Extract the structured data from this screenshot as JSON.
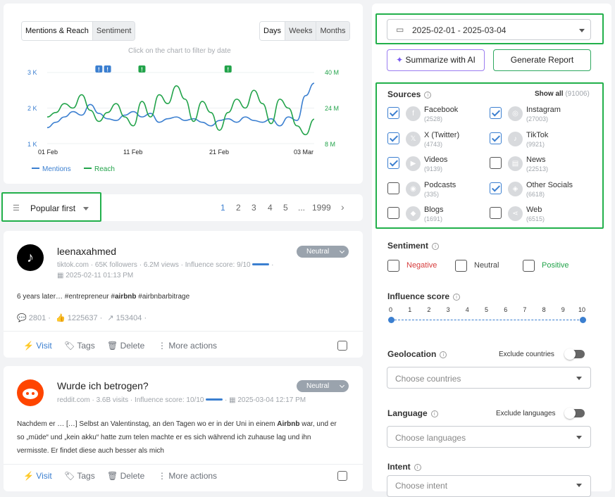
{
  "chart": {
    "tabs": [
      "Mentions & Reach",
      "Sentiment"
    ],
    "period_tabs": [
      "Days",
      "Weeks",
      "Months"
    ],
    "hint": "Click on the chart to filter by date",
    "y_left_ticks": [
      "3 K",
      "2 K",
      "1 K"
    ],
    "y_right_ticks": [
      "40 M",
      "24 M",
      "8 M"
    ],
    "x_ticks": [
      "01 Feb",
      "11 Feb",
      "21 Feb",
      "03 Mar"
    ],
    "legend": [
      "Mentions",
      "Reach"
    ],
    "colors": {
      "mentions": "#3b7fd0",
      "reach": "#22a34a"
    }
  },
  "chart_data": {
    "type": "line",
    "x": [
      "2025-02-01",
      "2025-02-02",
      "2025-02-03",
      "2025-02-04",
      "2025-02-05",
      "2025-02-06",
      "2025-02-07",
      "2025-02-08",
      "2025-02-09",
      "2025-02-10",
      "2025-02-11",
      "2025-02-12",
      "2025-02-13",
      "2025-02-14",
      "2025-02-15",
      "2025-02-16",
      "2025-02-17",
      "2025-02-18",
      "2025-02-19",
      "2025-02-20",
      "2025-02-21",
      "2025-02-22",
      "2025-02-23",
      "2025-02-24",
      "2025-02-25",
      "2025-02-26",
      "2025-02-27",
      "2025-02-28",
      "2025-03-01",
      "2025-03-02",
      "2025-03-03",
      "2025-03-04"
    ],
    "series": [
      {
        "name": "Mentions",
        "axis": "left",
        "values": [
          1450,
          1600,
          1750,
          1900,
          1800,
          2100,
          1850,
          1700,
          1650,
          1800,
          1900,
          1750,
          1850,
          1600,
          1700,
          1750,
          1650,
          1700,
          1600,
          1500,
          1650,
          1700,
          1600,
          1750,
          1650,
          1600,
          1700,
          1500,
          1750,
          1650,
          2350,
          2700
        ]
      },
      {
        "name": "Reach",
        "axis": "right",
        "values": [
          20,
          22,
          26,
          24,
          30,
          23,
          18,
          22,
          26,
          20,
          16,
          27,
          20,
          30,
          26,
          34,
          28,
          18,
          27,
          22,
          14,
          22,
          28,
          24,
          32,
          26,
          17,
          28,
          24,
          16,
          12,
          19
        ]
      }
    ],
    "ylim_left": [
      1000,
      3000
    ],
    "ylim_right": [
      8,
      40
    ],
    "flag_markers": [
      "!",
      "!",
      "!",
      "!"
    ]
  },
  "sort": {
    "label": "Popular first"
  },
  "pagination": {
    "pages": [
      "1",
      "2",
      "3",
      "4",
      "5",
      "...",
      "1999"
    ],
    "next": "›"
  },
  "posts": [
    {
      "author": "leenaxahmed",
      "sentiment": "Neutral",
      "meta": [
        "tiktok.com",
        "65K followers",
        "6.2M views",
        "Influence score: 9/10"
      ],
      "date": "2025-02-11 01:13 PM",
      "text_pre": "6 years later… #entrepreneur #",
      "text_bold": "airbnb",
      "text_post": " #airbnbarbitrage",
      "stats": {
        "comments": "2801",
        "likes": "1225637",
        "shares": "153404"
      }
    },
    {
      "author": "Wurde ich betrogen?",
      "sentiment": "Neutral",
      "meta": [
        "reddit.com",
        "3.6B visits",
        "Influence score: 10/10"
      ],
      "date": "2025-03-04 12:17 PM",
      "line1_pre": "Nachdem er … […] Selbst an Valentinstag, an den Tagen wo er in der Uni in einem ",
      "line1_bold": "Airbnb",
      "line1_post": " war, und er",
      "line2": "so „müde“ und „kein akku“ hatte zum telen machte er es sich während ich zuhause lag und ihn",
      "line3": "vermisste. Er findet diese auch besser als mich"
    }
  ],
  "actions": {
    "visit": "Visit",
    "tags": "Tags",
    "delete": "Delete",
    "more": "More actions"
  },
  "filters": {
    "date_range": "2025-02-01 - 2025-03-04",
    "summarize": "Summarize with AI",
    "report": "Generate Report",
    "sources_title": "Sources",
    "show_all": "Show all",
    "show_all_count": "(91006)",
    "sources": [
      {
        "name": "Facebook",
        "count": "(2528)",
        "checked": true
      },
      {
        "name": "Instagram",
        "count": "(27003)",
        "checked": true
      },
      {
        "name": "X (Twitter)",
        "count": "(4743)",
        "checked": true
      },
      {
        "name": "TikTok",
        "count": "(9921)",
        "checked": true
      },
      {
        "name": "Videos",
        "count": "(9139)",
        "checked": true
      },
      {
        "name": "News",
        "count": "(22513)",
        "checked": false
      },
      {
        "name": "Podcasts",
        "count": "(335)",
        "checked": false
      },
      {
        "name": "Other Socials",
        "count": "(6618)",
        "checked": true
      },
      {
        "name": "Blogs",
        "count": "(1691)",
        "checked": false
      },
      {
        "name": "Web",
        "count": "(6515)",
        "checked": false
      }
    ],
    "sentiment_title": "Sentiment",
    "sentiment_opts": [
      "Negative",
      "Neutral",
      "Positive"
    ],
    "influence_title": "Influence score",
    "influence_ticks": [
      "0",
      "1",
      "2",
      "3",
      "4",
      "5",
      "6",
      "7",
      "8",
      "9",
      "10"
    ],
    "influence_range": [
      0,
      10
    ],
    "geo_title": "Geolocation",
    "geo_exclude": "Exclude countries",
    "geo_placeholder": "Choose countries",
    "lang_title": "Language",
    "lang_exclude": "Exclude languages",
    "lang_placeholder": "Choose languages",
    "intent_title": "Intent",
    "intent_placeholder": "Choose intent"
  }
}
